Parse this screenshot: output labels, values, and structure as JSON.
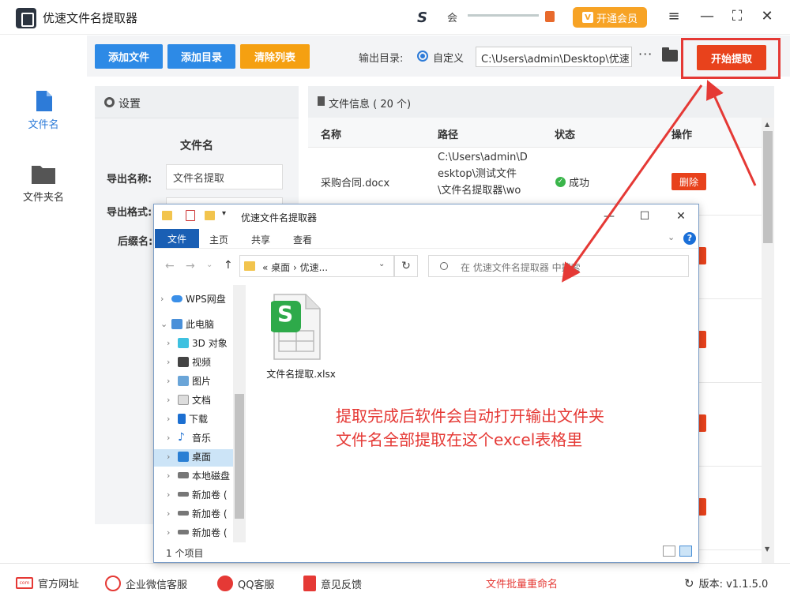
{
  "app": {
    "title": "优速文件名提取器",
    "brand_text": "会",
    "vip_label": "开通会员",
    "vip_icon_char": "V"
  },
  "sidebar": {
    "items": [
      {
        "label": "文件名",
        "icon": "file-icon"
      },
      {
        "label": "文件夹名",
        "icon": "folder-icon"
      }
    ]
  },
  "toolbar": {
    "add_file": "添加文件",
    "add_dir": "添加目录",
    "clear_list": "清除列表",
    "output_label": "输出目录:",
    "radio_label": "自定义",
    "output_path": "C:\\Users\\admin\\Desktop\\优速",
    "more": "···",
    "start": "开始提取"
  },
  "settings": {
    "title": "设置",
    "section": "文件名",
    "export_name_label": "导出名称:",
    "export_name_value": "文件名提取",
    "export_format_label": "导出格式:",
    "suffix_label": "后缀名:"
  },
  "file_info": {
    "title": "文件信息 ( 20 个)",
    "columns": [
      "名称",
      "路径",
      "状态",
      "操作"
    ],
    "row1": {
      "name": "采购合同.docx",
      "path_lines": [
        "C:\\Users\\admin\\D",
        "esktop\\测试文件",
        "\\文件名提取器\\wo"
      ],
      "status": "成功",
      "action": "删除"
    }
  },
  "statusbar": {
    "website": "官方网址",
    "wechat": "企业微信客服",
    "qq": "QQ客服",
    "feedback": "意见反馈",
    "batch_rename": "文件批量重命名",
    "version": "版本: v1.1.5.0"
  },
  "explorer": {
    "title": "优速文件名提取器",
    "tabs": [
      "文件",
      "主页",
      "共享",
      "查看"
    ],
    "address": "« 桌面 › 优速...",
    "search_placeholder": "在 优速文件名提取器 中搜索",
    "tree": [
      "WPS网盘",
      "此电脑",
      "3D 对象",
      "视频",
      "图片",
      "文档",
      "下载",
      "音乐",
      "桌面",
      "本地磁盘",
      "新加卷 (",
      "新加卷 (",
      "新加卷 ("
    ],
    "file_name": "文件名提取.xlsx",
    "file_icon_letter": "S",
    "item_count": "1 个项目",
    "help": "?"
  },
  "annotation": {
    "line1": "提取完成后软件会自动打开输出文件夹",
    "line2": "文件名全部提取在这个excel表格里"
  },
  "colors": {
    "blue_button": "#2d8ae6",
    "orange_button": "#f5a011",
    "red_button": "#e8421c",
    "annotation_red": "#e53935",
    "vip_orange": "#f7a325"
  }
}
